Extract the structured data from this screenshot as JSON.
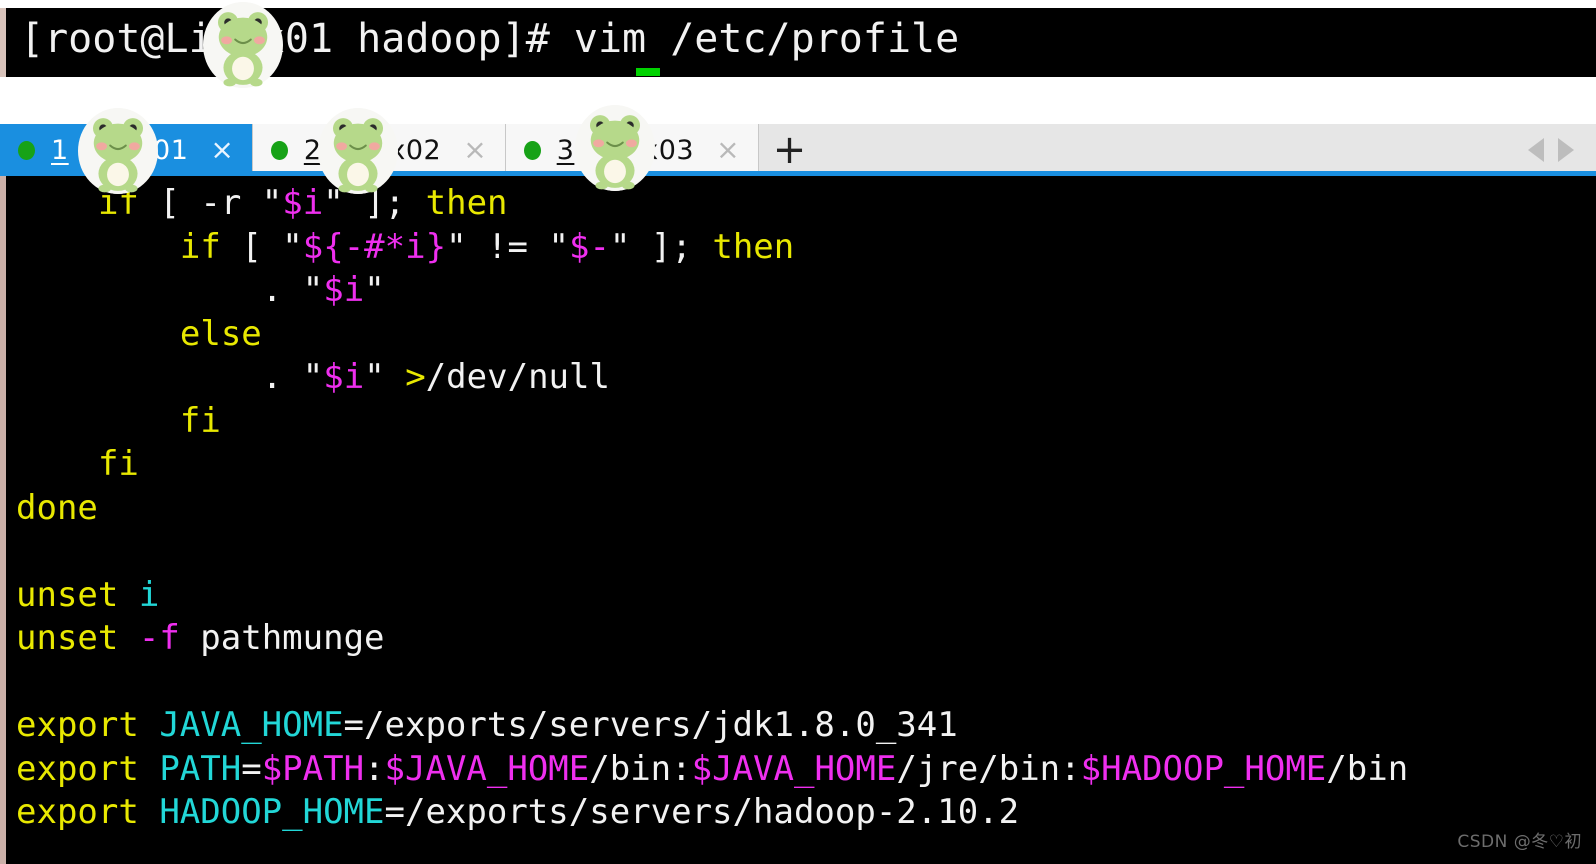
{
  "prompt": {
    "text": "[root@Linux01 hadoop]# vim /etc/profile",
    "cursor": "block-cursor"
  },
  "tabbar": {
    "new_tab_label": "+",
    "close_label": "×",
    "tabs": [
      {
        "index": "1",
        "name": "Linux01",
        "label": "1 Linux01",
        "active": true,
        "status": "connected",
        "close": "×"
      },
      {
        "index": "2",
        "name": "Linux02",
        "label": "2 Linux02",
        "active": false,
        "status": "connected",
        "close": "×"
      },
      {
        "index": "3",
        "name": "Linux03",
        "label": "3 Linux03",
        "active": false,
        "status": "connected",
        "close": "×"
      }
    ],
    "scroll_left": "◀",
    "scroll_right": "▶"
  },
  "editor": {
    "file": "/etc/profile",
    "lines": [
      "    if [ -r \"$i\" ]; then",
      "        if [ \"${-#*i}\" != \"$-\" ]; then",
      "            . \"$i\"",
      "        else",
      "            . \"$i\" >/dev/null",
      "        fi",
      "    fi",
      "done",
      "",
      "unset i",
      "unset -f pathmunge",
      "",
      "export JAVA_HOME=/exports/servers/jdk1.8.0_341",
      "export PATH=$PATH:$JAVA_HOME/bin:$JAVA_HOME/jre/bin:$HADOOP_HOME/bin",
      "export HADOOP_HOME=/exports/servers/hadoop-2.10.2"
    ]
  },
  "watermark": {
    "text": "CSDN @冬♡初"
  },
  "colors": {
    "keyword": "#e8e800",
    "variable": "#ef2fef",
    "identifier": "#22d7d7",
    "plain": "#f2f2f2",
    "tab_active_bg": "#1a8fe0",
    "tab_status_dot": "#17a217",
    "terminal_bg": "#000000",
    "cursor": "#00d200"
  }
}
